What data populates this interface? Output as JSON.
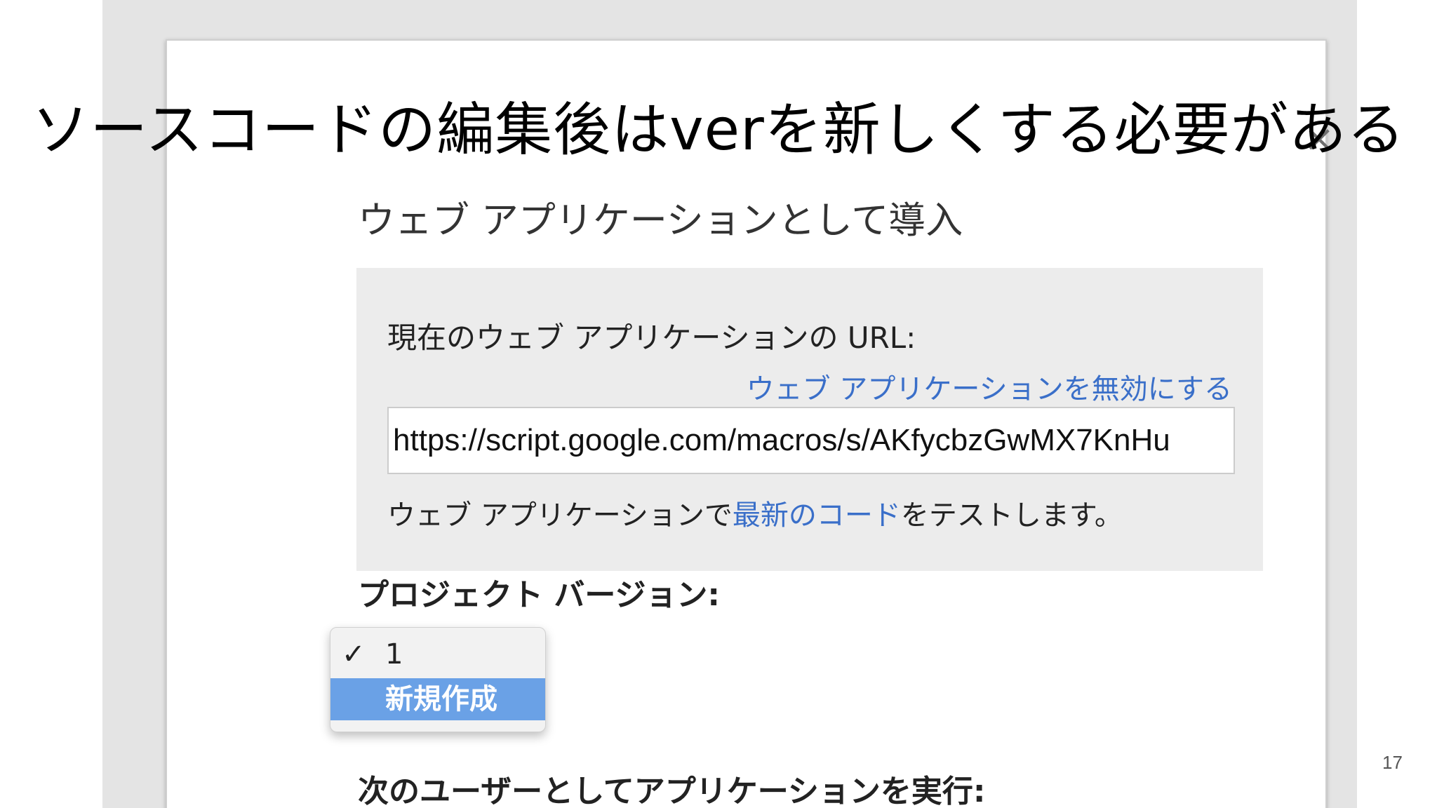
{
  "slide": {
    "title": "ソースコードの編集後はverを新しくする必要がある",
    "page_number": "17"
  },
  "dialog": {
    "close_icon": "×",
    "title": "ウェブ アプリケーションとして導入",
    "current_url_label": "現在のウェブ アプリケーションの URL:",
    "disable_link": "ウェブ アプリケーションを無効にする",
    "url_value": "https://script.google.com/macros/s/AKfycbzGwMX7KnHu",
    "test_prefix": "ウェブ アプリケーションで",
    "test_link": "最新のコード",
    "test_suffix": "をテストします。",
    "project_version_label": "プロジェクト バージョン:",
    "version_options": [
      "1",
      "新規作成"
    ],
    "check_mark": "✓",
    "run_as_label": "次のユーザーとしてアプリケーションを実行:"
  },
  "colors": {
    "link": "#3a6fc9",
    "selected_option": "#6aa1e6",
    "url_box_bg": "#ececec"
  }
}
